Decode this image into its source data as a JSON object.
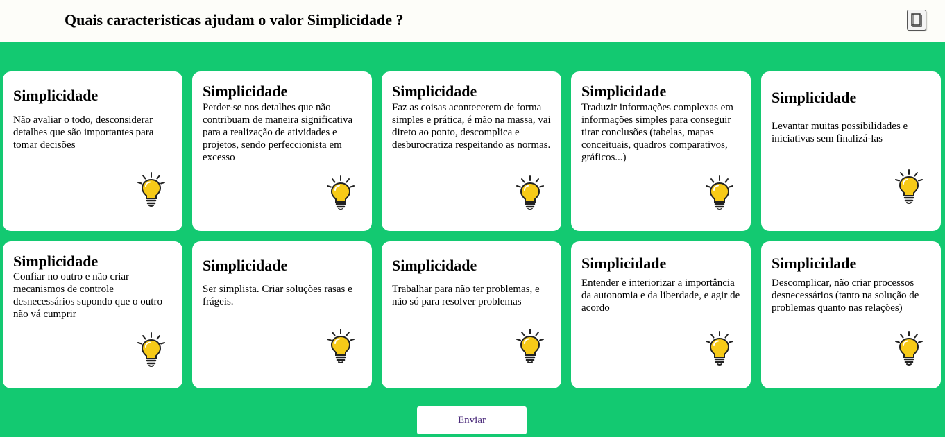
{
  "header": {
    "title": "Quais caracteristicas ajudam o valor Simplicidade ?",
    "book_icon": "book-icon"
  },
  "cards": [
    {
      "title": "Simplicidade",
      "text": "Não avaliar o todo, desconsiderar detalhes que são importantes para tomar decisões"
    },
    {
      "title": "Simplicidade",
      "text": "Perder-se nos detalhes que não contribuam de maneira significativa para a realização de atividades e projetos, sendo perfeccionista em excesso"
    },
    {
      "title": "Simplicidade",
      "text": "Faz as coisas acontecerem de forma simples e prática, é mão na massa, vai direto ao ponto, descomplica e desburocratiza respeitando as normas."
    },
    {
      "title": "Simplicidade",
      "text": "Traduzir informações complexas em informações simples para conseguir tirar conclusões (tabelas, mapas conceituais, quadros comparativos, gráficos...)"
    },
    {
      "title": "Simplicidade",
      "text": "Levantar muitas possibilidades e iniciativas sem finalizá-las"
    },
    {
      "title": "Simplicidade",
      "text": "Confiar no outro e não criar mecanismos de controle desnecessários supondo que o outro não vá cumprir"
    },
    {
      "title": "Simplicidade",
      "text": "Ser simplista. Criar soluções rasas e frágeis."
    },
    {
      "title": "Simplicidade",
      "text": "Trabalhar para não ter problemas, e não só para resolver problemas"
    },
    {
      "title": "Simplicidade",
      "text": "Entender e interiorizar a importância da autonomia e da liberdade, e agir de acordo"
    },
    {
      "title": "Simplicidade",
      "text": "Descomplicar, não criar processos desnecessários (tanto na solução de problemas quanto nas relações)"
    }
  ],
  "card_icon": "lightbulb-icon",
  "submit_label": "Enviar",
  "colors": {
    "background": "#13c971",
    "header": "#fdfdf9",
    "card": "#ffffff",
    "bulb": "#f7ca18",
    "button_text": "#4a2a7a"
  }
}
